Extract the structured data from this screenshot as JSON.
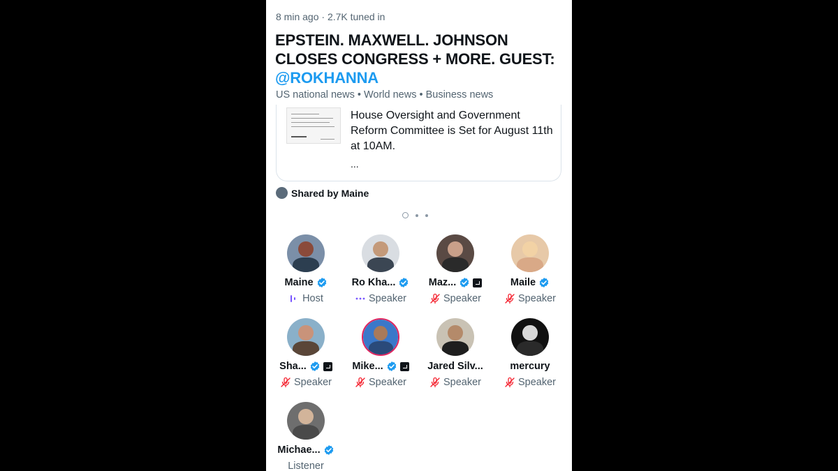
{
  "space": {
    "time_ago": "8 min ago",
    "separator": "·",
    "tuned_in": "2.7K tuned in",
    "title_main": "EPSTEIN. MAXWELL. JOHNSON CLOSES CONGRESS + MORE.  GUEST:",
    "title_handle": "@ROKHANNA",
    "topics": "US national news • World news • Business news"
  },
  "card": {
    "text": "House Oversight and Government Reform Committee is Set for August 11th at 10AM.",
    "ellipsis": "..."
  },
  "shared_by": "Shared by Maine",
  "pager": {
    "count": 3,
    "active_index": 0
  },
  "participants": [
    {
      "name": "Maine",
      "verified": true,
      "affiliate": false,
      "role": "Host",
      "role_icon": "host-mic-icon",
      "colors": [
        "#7b8fa8",
        "#2c3e50",
        "#8a4a3a"
      ]
    },
    {
      "name": "Ro Kha...",
      "verified": true,
      "affiliate": false,
      "role": "Speaker",
      "role_icon": "speaking-dots-icon",
      "colors": [
        "#d9dde2",
        "#3b4653",
        "#c49a7a"
      ]
    },
    {
      "name": "Maz...",
      "verified": true,
      "affiliate": true,
      "role": "Speaker",
      "role_icon": "mic-muted-icon",
      "colors": [
        "#5a4a44",
        "#2a2a2a",
        "#c9a08a"
      ]
    },
    {
      "name": "Maile",
      "verified": true,
      "affiliate": false,
      "role": "Speaker",
      "role_icon": "mic-muted-icon",
      "colors": [
        "#e7c9a8",
        "#d9a987",
        "#f2d2a5"
      ]
    },
    {
      "name": "Sha...",
      "verified": true,
      "affiliate": true,
      "role": "Speaker",
      "role_icon": "mic-muted-icon",
      "colors": [
        "#8ab0c9",
        "#5a4638",
        "#c9937a"
      ]
    },
    {
      "name": "Mike...",
      "verified": true,
      "affiliate": true,
      "role": "Speaker",
      "role_icon": "mic-muted-icon",
      "ring": true,
      "colors": [
        "#3a78c9",
        "#2a4a7a",
        "#a87a5a"
      ]
    },
    {
      "name": "Jared Silv...",
      "verified": false,
      "affiliate": false,
      "role": "Speaker",
      "role_icon": "mic-muted-icon",
      "colors": [
        "#c9c2b4",
        "#1e1e1e",
        "#b48a6a"
      ]
    },
    {
      "name": "mercury",
      "verified": false,
      "affiliate": false,
      "role": "Speaker",
      "role_icon": "mic-muted-icon",
      "colors": [
        "#111111",
        "#2a2a2a",
        "#d8d8d8"
      ]
    },
    {
      "name": "Michae...",
      "verified": true,
      "affiliate": false,
      "role": "Listener",
      "role_icon": "",
      "colors": [
        "#6e6e6e",
        "#4a4a4a",
        "#d2b49a"
      ]
    }
  ],
  "colors": {
    "verified_blue": "#1d9bf0",
    "host_purple": "#7856ff",
    "muted_red": "#f4212e",
    "secondary_text": "#536471"
  }
}
